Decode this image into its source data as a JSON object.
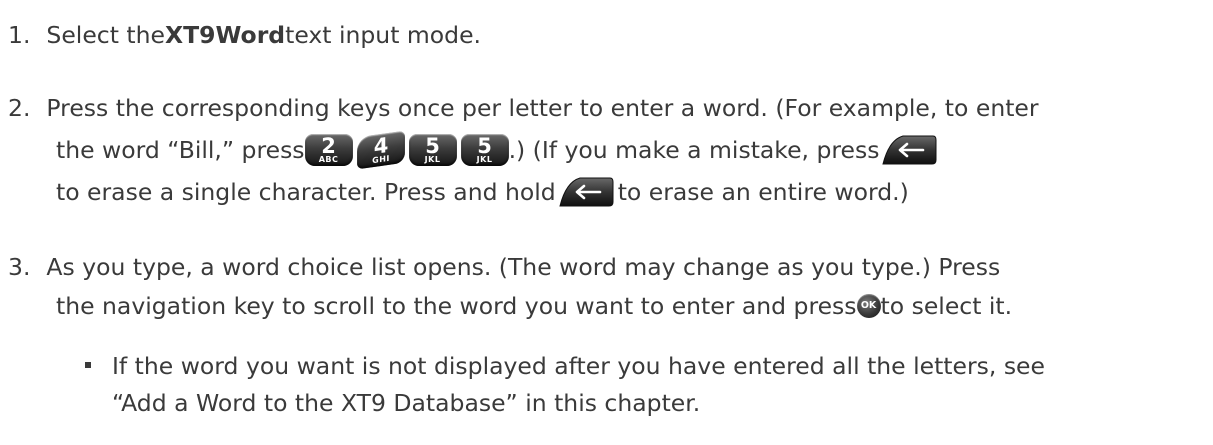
{
  "steps": [
    {
      "number": "1.",
      "lines": [
        [
          "Select the ",
          "XT9Word",
          " text input mode."
        ]
      ]
    },
    {
      "number": "2.",
      "lines": [
        [
          "Press the corresponding keys once per letter to enter a word. (For example, to enter"
        ],
        [
          "the word “Bill,” press ",
          ".) (If you make a mistake, press "
        ],
        [
          "to erase a single character. Press and hold ",
          " to erase an entire word.)"
        ]
      ]
    },
    {
      "number": "3.",
      "lines": [
        [
          "As you type, a word choice list opens. (The word may change as you type.) Press"
        ],
        [
          "the navigation key to scroll to the word you want to enter and press ",
          " to select it."
        ]
      ]
    }
  ],
  "sub_bullet": {
    "lines": [
      "If the word you want is not displayed after you have entered all the letters, see",
      "“Add a Word to the XT9 Database” in this chapter."
    ]
  },
  "keys": {
    "key_2": {
      "digit": "2",
      "letters": "ABC"
    },
    "key_4": {
      "digit": "4",
      "letters": "GHI"
    },
    "key_5a": {
      "digit": "5",
      "letters": "JKL"
    },
    "key_5b": {
      "digit": "5",
      "letters": "JKL"
    },
    "ok": {
      "label": "OK"
    },
    "back_icon": "backspace-key-icon",
    "ok_icon": "ok-key-icon"
  }
}
